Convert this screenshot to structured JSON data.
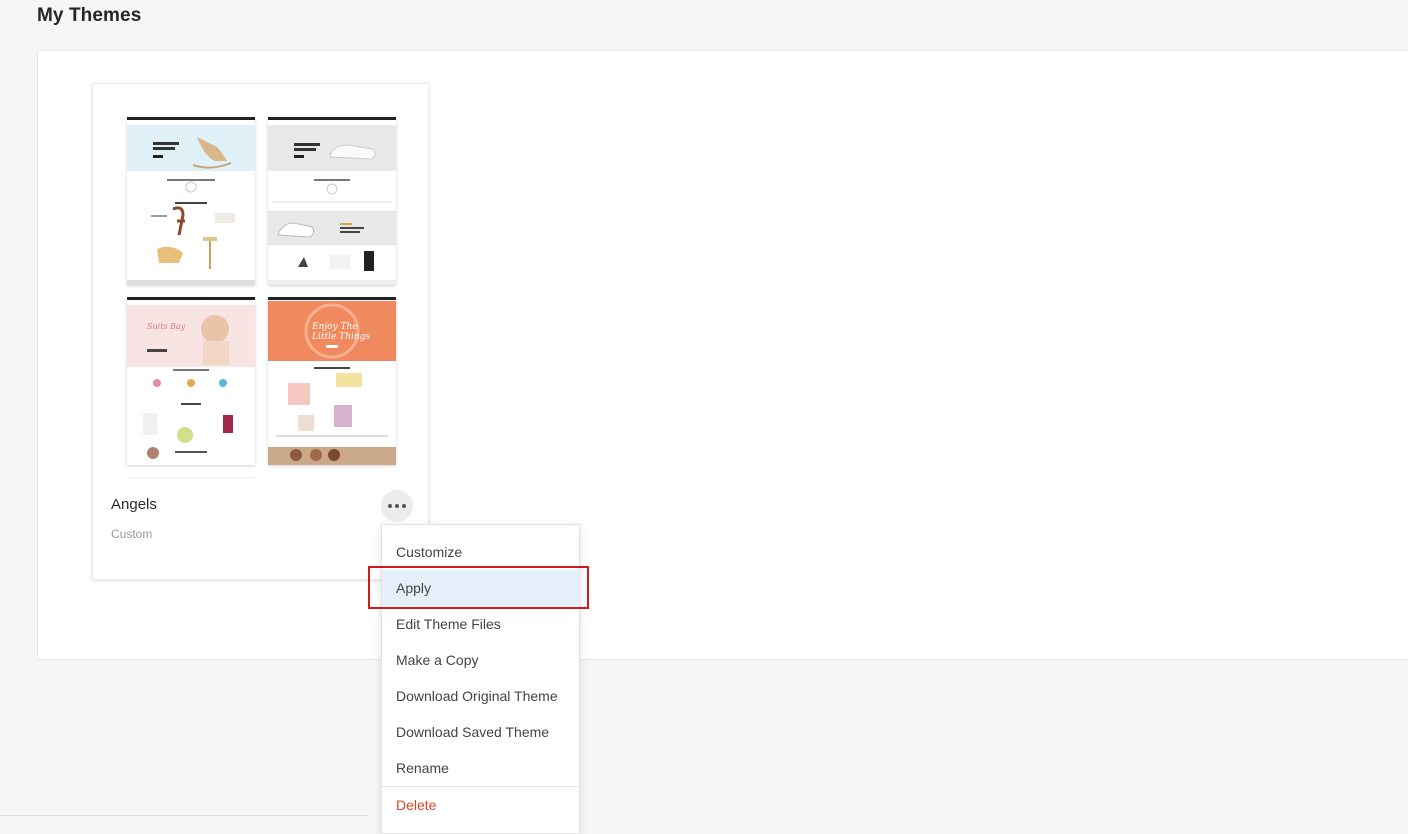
{
  "page": {
    "title": "My Themes"
  },
  "theme": {
    "name": "Angels",
    "type": "Custom"
  },
  "menu": {
    "items": [
      {
        "label": "Customize",
        "selected": false
      },
      {
        "label": "Apply",
        "selected": true
      },
      {
        "label": "Edit Theme Files",
        "selected": false
      },
      {
        "label": "Make a Copy",
        "selected": false
      },
      {
        "label": "Download Original Theme",
        "selected": false
      },
      {
        "label": "Download Saved Theme",
        "selected": false
      },
      {
        "label": "Rename",
        "selected": false
      }
    ],
    "delete_label": "Delete"
  },
  "colors": {
    "selected_bg": "#e5f0fa",
    "highlight_border": "#d21a1a",
    "danger": "#d9472b"
  }
}
